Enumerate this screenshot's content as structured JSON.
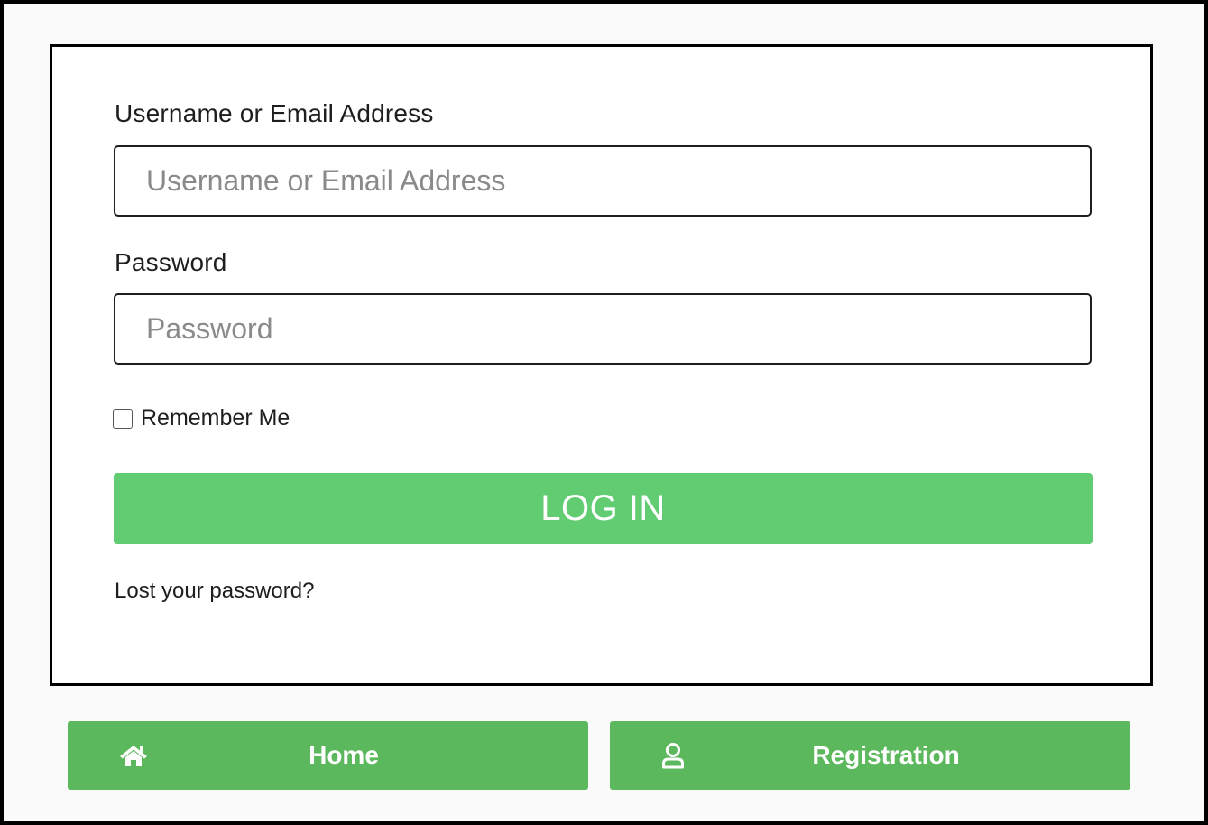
{
  "form": {
    "username": {
      "label": "Username or Email Address",
      "placeholder": "Username or Email Address",
      "value": ""
    },
    "password": {
      "label": "Password",
      "placeholder": "Password",
      "value": ""
    },
    "remember_me": {
      "label": "Remember Me",
      "checked": false
    },
    "submit_label": "LOG IN",
    "lost_password_link": "Lost your password?"
  },
  "nav": {
    "home": {
      "label": "Home",
      "icon": "home-icon"
    },
    "registration": {
      "label": "Registration",
      "icon": "user-icon"
    }
  },
  "colors": {
    "login_button": "#62cc73",
    "nav_button": "#5cb85c",
    "button_text": "#ffffff"
  }
}
